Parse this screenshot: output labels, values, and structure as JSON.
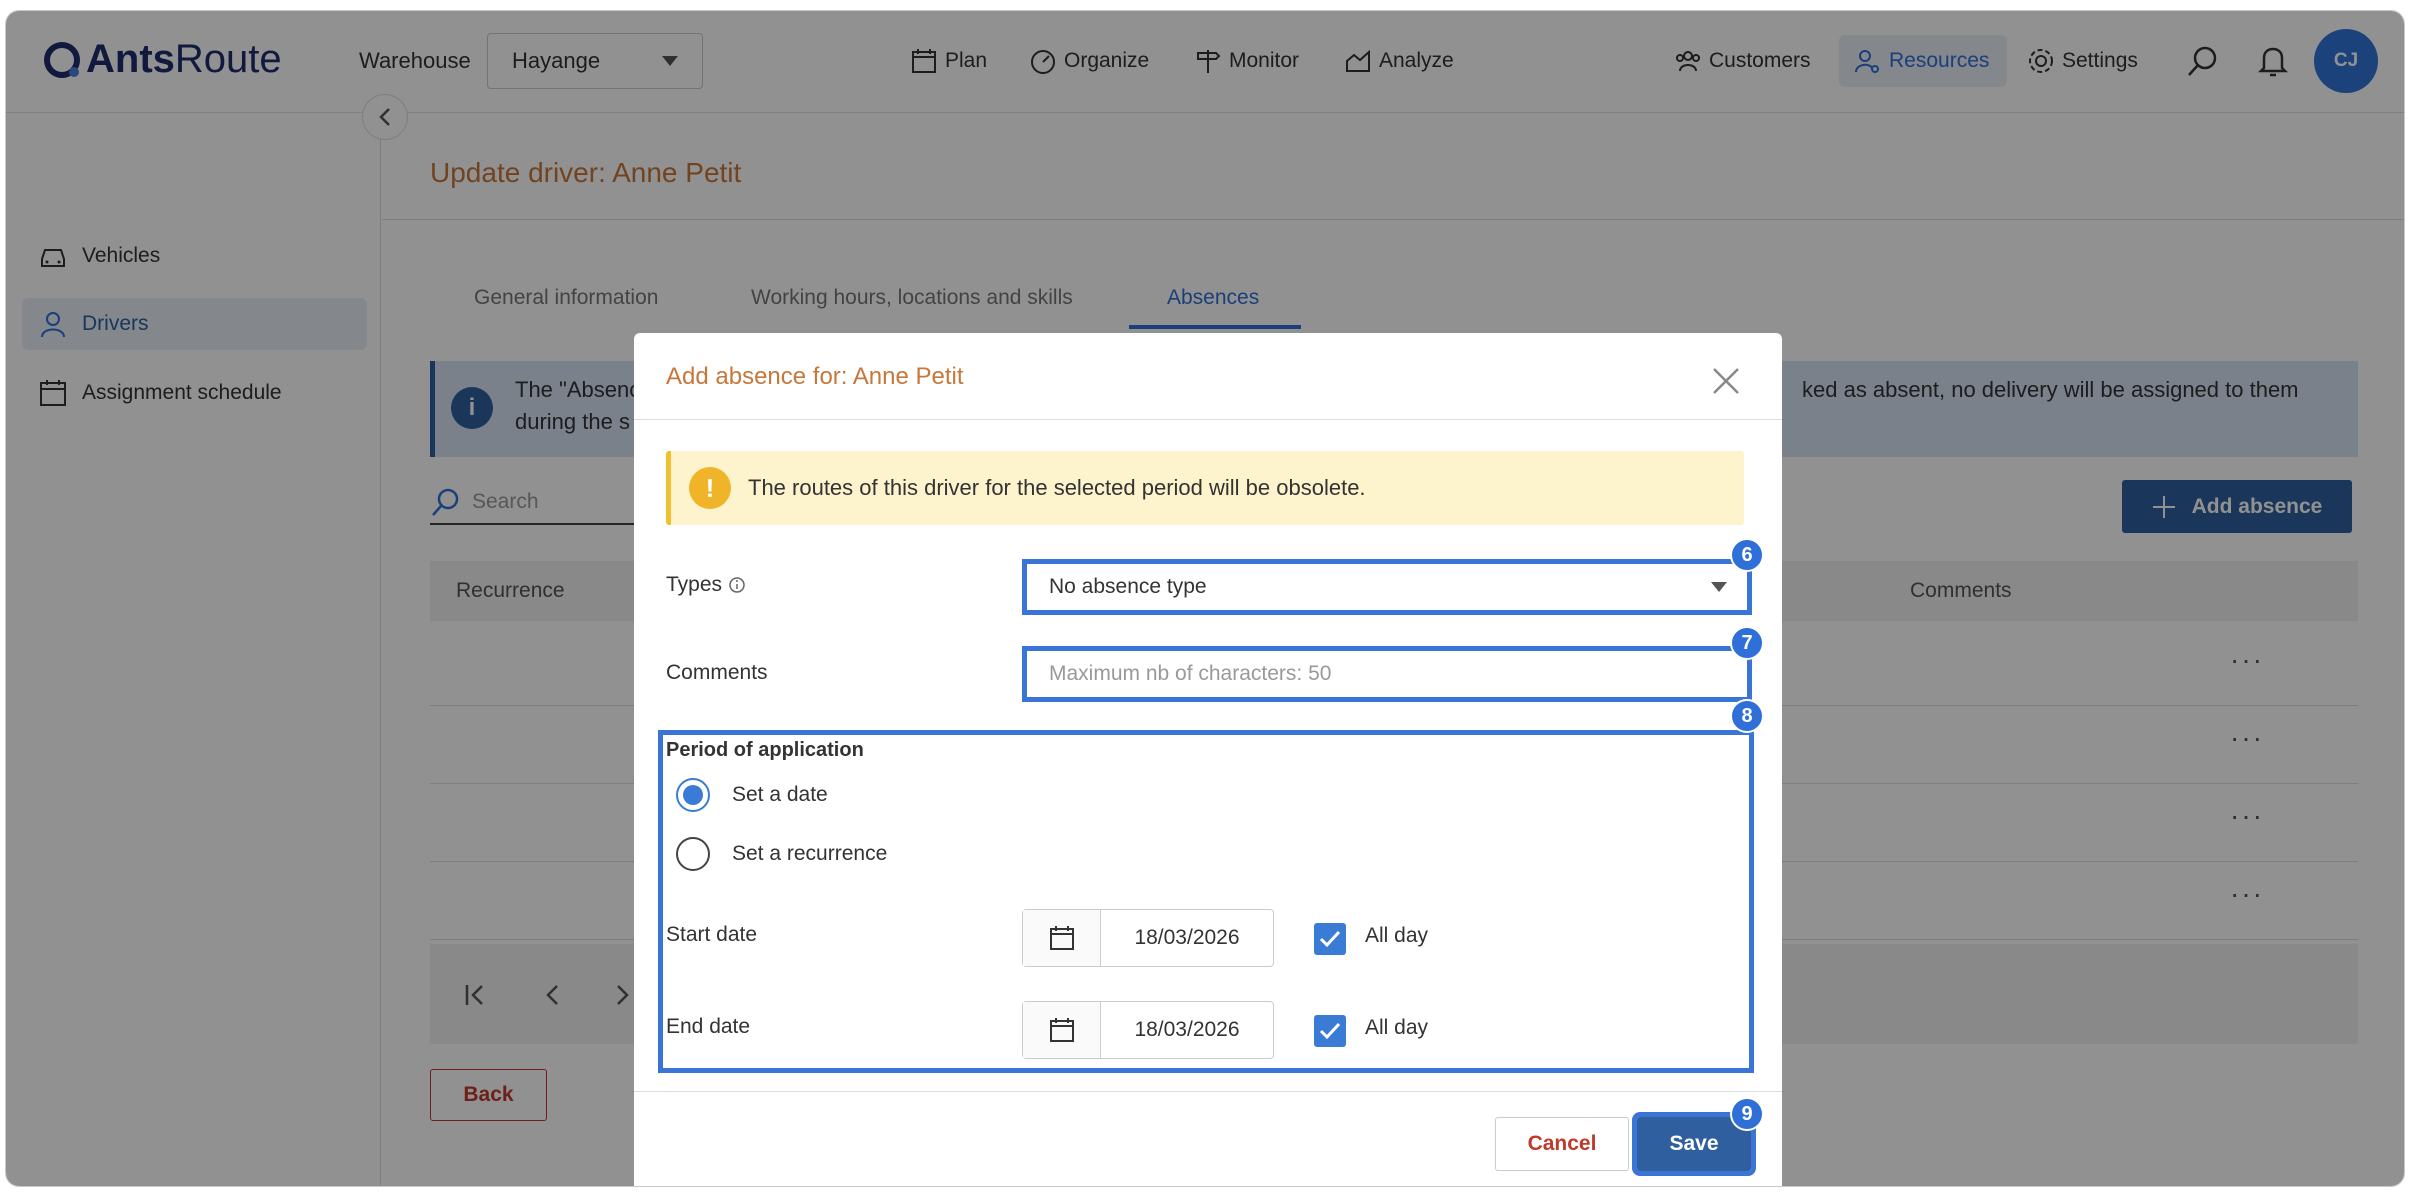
{
  "header": {
    "logo_text_bold": "Ants",
    "logo_text_light": "Route",
    "warehouse_label": "Warehouse",
    "warehouse_value": "Hayange",
    "nav": {
      "plan": "Plan",
      "organize": "Organize",
      "monitor": "Monitor",
      "analyze": "Analyze",
      "customers": "Customers",
      "resources": "Resources",
      "settings": "Settings"
    },
    "avatar_initials": "CJ"
  },
  "sidebar": {
    "items": [
      {
        "label": "Vehicles"
      },
      {
        "label": "Drivers"
      },
      {
        "label": "Assignment schedule"
      }
    ]
  },
  "page": {
    "title": "Update driver: Anne Petit",
    "tabs": [
      "General information",
      "Working hours, locations and skills",
      "Absences"
    ],
    "info_text_start": "The \"Absenc",
    "info_text_line2": "during the s",
    "info_text_end": "ked as absent, no delivery will be assigned to them",
    "search_placeholder": "Search",
    "add_absence_label": "Add absence",
    "table_headers": {
      "recurrence": "Recurrence",
      "comments": "Comments"
    },
    "row_menu": "···",
    "back_label": "Back"
  },
  "modal": {
    "title": "Add absence for: Anne Petit",
    "warning": "The routes of this driver for the selected period will be obsolete.",
    "types_label": "Types",
    "types_value": "No absence type",
    "comments_label": "Comments",
    "comments_placeholder": "Maximum nb of characters: 50",
    "period_label": "Period of application",
    "radio_date": "Set a date",
    "radio_recurrence": "Set a recurrence",
    "start_label": "Start date",
    "start_value": "18/03/2026",
    "end_label": "End date",
    "end_value": "18/03/2026",
    "all_day": "All day",
    "cancel_label": "Cancel",
    "save_label": "Save"
  },
  "annotations": [
    "6",
    "7",
    "8",
    "9"
  ],
  "colors": {
    "accent_blue": "#2f5f9e",
    "title_orange": "#c8773a",
    "highlight_blue": "#3a75d6",
    "warning_bg": "#fdf3cd"
  }
}
